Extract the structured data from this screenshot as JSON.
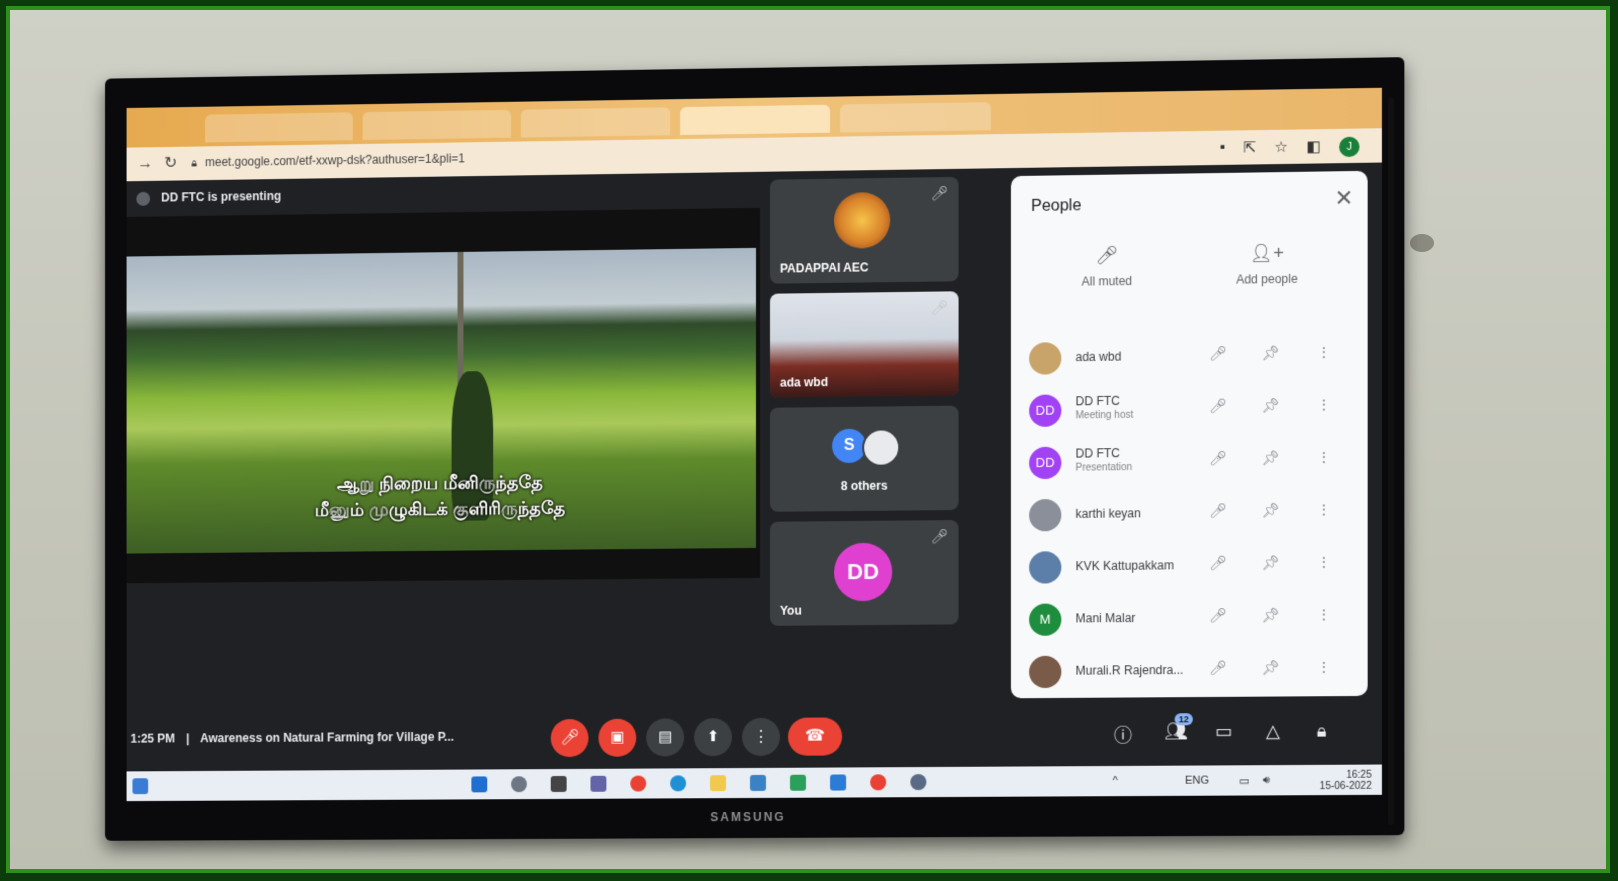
{
  "browser": {
    "url": "meet.google.com/etf-xxwp-dsk?authuser=1&pli=1",
    "profile_initial": "J"
  },
  "meet": {
    "presenting_banner": "DD FTC is presenting",
    "subtitle_line1": "ஆறு நிறைய மீனிருந்ததே",
    "subtitle_line2": "மீனும் முழுகிடக் குளிரிருந்ததே",
    "clock": "1:25 PM",
    "separator": "|",
    "meeting_title": "Awareness on Natural Farming for Village P...",
    "participant_count_badge": "12"
  },
  "tiles": [
    {
      "name": "PADAPPAI AEC"
    },
    {
      "name": "ada wbd"
    },
    {
      "name": "8 others",
      "avatar_letter": "S"
    },
    {
      "name": "You",
      "avatar_letter": "DD"
    }
  ],
  "people_panel": {
    "title": "People",
    "all_muted_label": "All muted",
    "add_people_label": "Add people",
    "participants": [
      {
        "name": "ada wbd",
        "role": "",
        "avatar": "",
        "avatar_color": "#c9a46a"
      },
      {
        "name": "DD FTC",
        "role": "Meeting host",
        "avatar": "DD",
        "avatar_color": "#a142f4"
      },
      {
        "name": "DD FTC",
        "role": "Presentation",
        "avatar": "DD",
        "avatar_color": "#a142f4"
      },
      {
        "name": "karthi keyan",
        "role": "",
        "avatar": "",
        "avatar_color": "#8a8f99"
      },
      {
        "name": "KVK Kattupakkam",
        "role": "",
        "avatar": "",
        "avatar_color": "#5b7fa8"
      },
      {
        "name": "Mani Malar",
        "role": "",
        "avatar": "M",
        "avatar_color": "#1e8e3e"
      },
      {
        "name": "Murali.R Rajendra...",
        "role": "",
        "avatar": "",
        "avatar_color": "#7a5a48"
      }
    ]
  },
  "taskbar": {
    "language": "ENG",
    "time": "16:25",
    "date": "15-06-2022"
  },
  "tv": {
    "brand": "SAMSUNG"
  },
  "colors": {
    "frame_border": "#2f8f1e",
    "meet_bg": "#202124",
    "end_call": "#ea4335",
    "host_avatar": "#a142f4"
  }
}
